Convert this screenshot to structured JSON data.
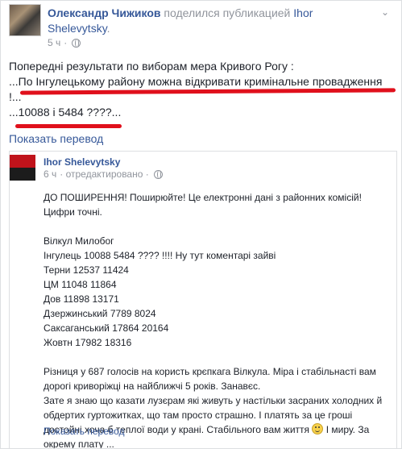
{
  "post": {
    "author": "Олександр Чижиков",
    "verb": "поделился публикацией",
    "shared_from": "Ihor Shelevytsky",
    "shared_suffix": ".",
    "time": "5 ч",
    "time_sep": "·",
    "text_lines": [
      "Попередні результати по виборам мера Кривого Рогу :",
      "...По Інгулецькому району можна відкривати кримінальне провадження",
      "!...",
      "...10088 і 5484 ????..."
    ],
    "translate_label": "Показать перевод"
  },
  "shared_post": {
    "author": "Ihor Shelevytsky",
    "time": "6 ч",
    "edited": "· отредактировано ·",
    "lines": [
      "ДО ПОШИРЕННЯ! Поширюйте! Це електронні дані з районних комісій!",
      "Цифри точні.",
      "",
      "Вілкул Милобог",
      "Інгулець 10088 5484 ???? !!!! Ну тут коментарі зайві",
      "Терни 12537 11424",
      "ЦМ 11048 11864",
      "Дов 11898 13171",
      "Дзержинський 7789 8024",
      "Саксаганський 17864 20164",
      "Жовтн 17982 18316",
      "",
      "Різниця у 687 голосів на користь крєпкага Вілкула. Міра і стабільнасті вам",
      "дорогі криворіжці на найближчі 5 років. Занавєс.",
      "Зате я знаю що казати лузєрам які живуть у настільки засраних холодних й",
      "обдертих гуртожитках, що там просто страшно. І платять за це гроші",
      "достойні хоча б теплої води у крані. Стабільного вам життя",
      "І миру. За",
      "окрему плату ..."
    ],
    "translate_label": "Показать перевод"
  },
  "icons": {
    "chevron": "chevron-down-icon",
    "globe": "globe-icon",
    "smile": "smile-emoji-icon"
  },
  "colors": {
    "link": "#365899",
    "meta": "#90949c",
    "highlight": "#e0101c"
  }
}
